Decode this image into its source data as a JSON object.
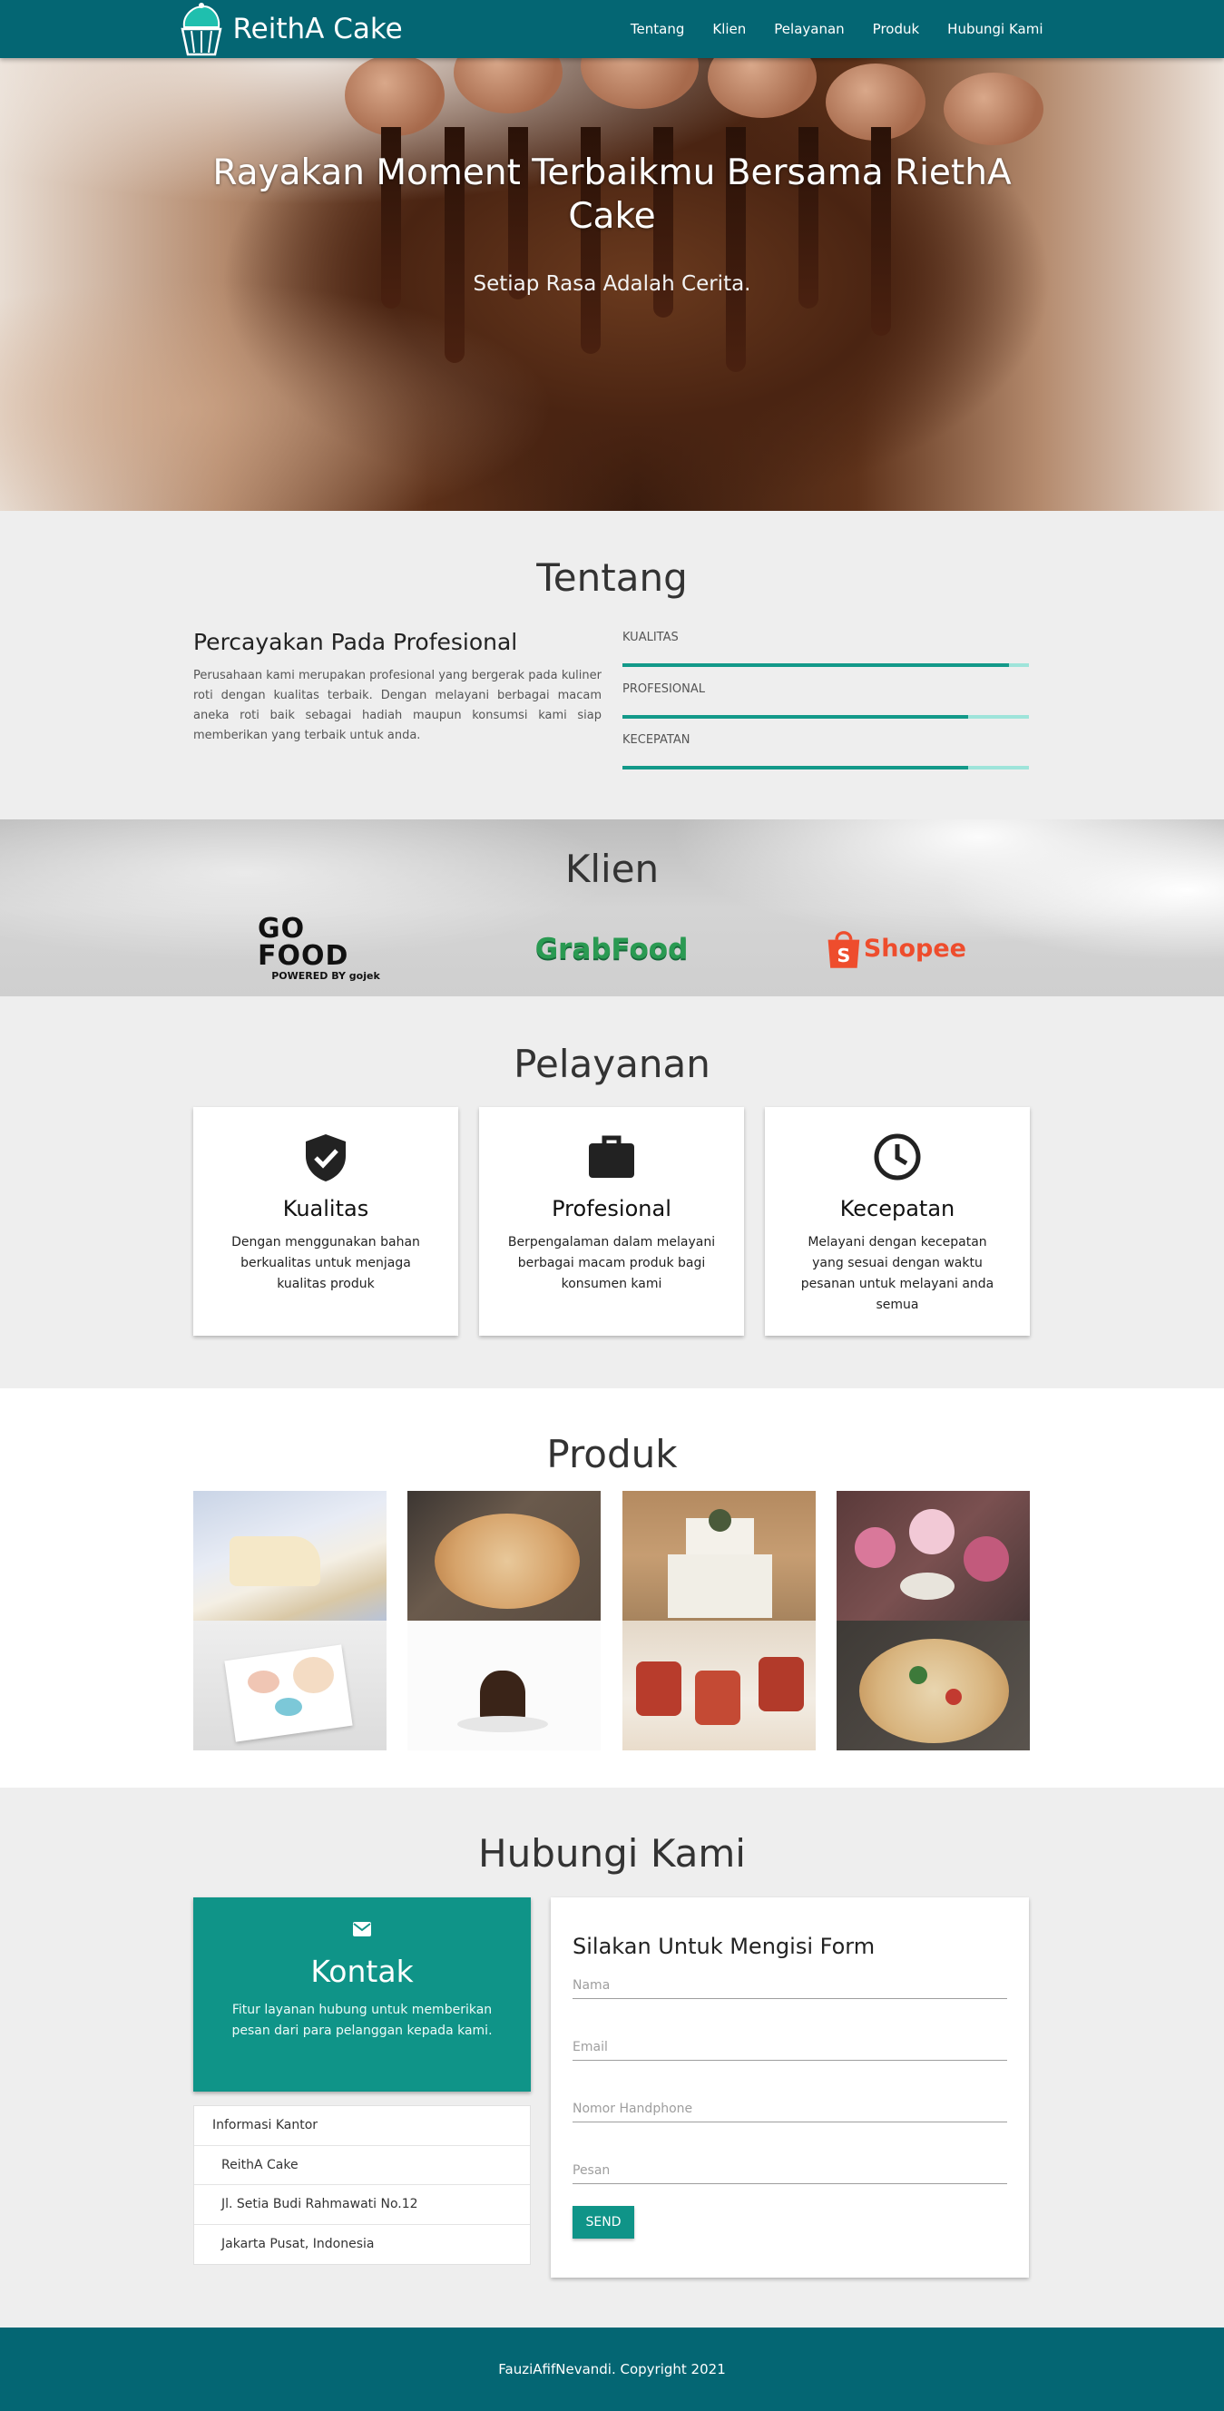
{
  "brand": {
    "name": "ReithA Cake"
  },
  "nav": [
    "Tentang",
    "Klien",
    "Pelayanan",
    "Produk",
    "Hubungi Kami"
  ],
  "hero": {
    "title": "Rayakan Moment Terbaikmu Bersama RiethA Cake",
    "subtitle": "Setiap Rasa Adalah Cerita."
  },
  "tentang": {
    "heading": "Tentang",
    "subheading": "Percayakan Pada Profesional",
    "text": "Perusahaan kami merupakan profesional yang bergerak pada kuliner roti dengan kualitas terbaik. Dengan melayani berbagai macam aneka roti baik sebagai hadiah maupun konsumsi kami siap memberikan yang terbaik untuk anda.",
    "skills": [
      {
        "label": "KUALITAS",
        "level": 0.95
      },
      {
        "label": "PROFESIONAL",
        "level": 0.85
      },
      {
        "label": "KECEPATAN",
        "level": 0.85
      }
    ]
  },
  "klien": {
    "heading": "Klien",
    "logos": [
      "GO FOOD",
      "POWERED BY gojek",
      "GrabFood",
      "Shopee"
    ]
  },
  "pelayanan": {
    "heading": "Pelayanan",
    "cards": [
      {
        "icon": "verified-shield-icon",
        "title": "Kualitas",
        "text": "Dengan menggunakan bahan berkualitas untuk menjaga kualitas produk"
      },
      {
        "icon": "briefcase-icon",
        "title": "Profesional",
        "text": "Berpengalaman dalam melayani berbagai macam produk bagi konsumen kami"
      },
      {
        "icon": "clock-icon",
        "title": "Kecepatan",
        "text": "Melayani dengan kecepatan yang sesuai dengan waktu pesanan untuk melayani anda semua"
      }
    ]
  },
  "produk": {
    "heading": "Produk"
  },
  "hubungi": {
    "heading": "Hubungi Kami",
    "kontak_title": "Kontak",
    "kontak_text": "Fitur layanan hubung untuk memberikan pesan dari para pelanggan kepada kami.",
    "info_head": "Informasi Kantor",
    "info_rows": [
      "ReithA Cake",
      "Jl. Setia Budi Rahmawati No.12",
      "Jakarta Pusat, Indonesia"
    ],
    "form_title": "Silakan Untuk Mengisi Form",
    "placeholders": {
      "nama": "Nama",
      "email": "Email",
      "phone": "Nomor Handphone",
      "pesan": "Pesan"
    },
    "send": "SEND"
  },
  "footer": {
    "text": "FauziAfifNevandi. Copyright 2021"
  },
  "colors": {
    "primary": "#046673",
    "accent": "#0f9488",
    "bar": "#129989"
  }
}
